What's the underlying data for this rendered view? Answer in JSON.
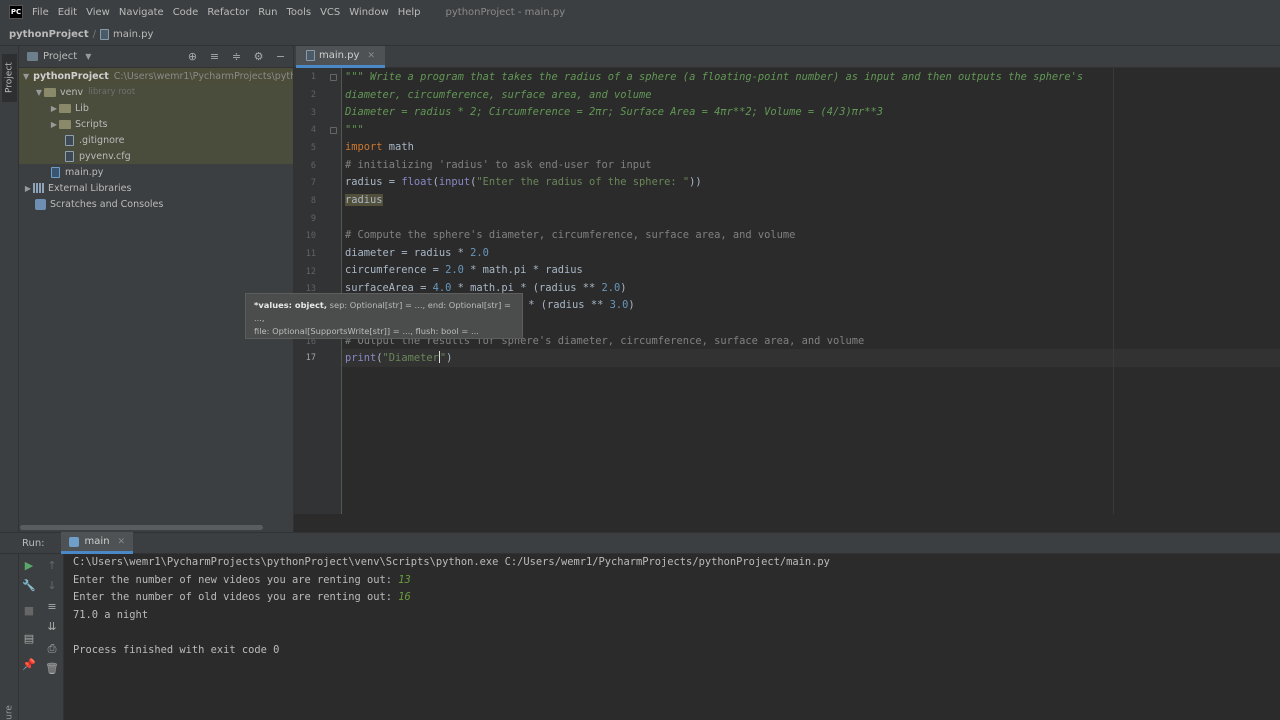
{
  "app": {
    "logo": "PC",
    "window_title": "pythonProject - main.py"
  },
  "menu": [
    "File",
    "Edit",
    "View",
    "Navigate",
    "Code",
    "Refactor",
    "Run",
    "Tools",
    "VCS",
    "Window",
    "Help"
  ],
  "breadcrumb": {
    "project": "pythonProject",
    "file": "main.py"
  },
  "left_strip": {
    "project_label": "Project",
    "structure_label": "Structure"
  },
  "project_panel": {
    "title": "Project",
    "tree": [
      {
        "label": "pythonProject",
        "path": "C:\\Users\\wemr1\\PycharmProjects\\pythor",
        "meta": ""
      },
      {
        "label": "venv",
        "meta": "library root"
      },
      {
        "label": "Lib"
      },
      {
        "label": "Scripts"
      },
      {
        "label": ".gitignore"
      },
      {
        "label": "pyvenv.cfg"
      },
      {
        "label": "main.py"
      },
      {
        "label": "External Libraries"
      },
      {
        "label": "Scratches and Consoles"
      }
    ]
  },
  "editor": {
    "tab_label": "main.py",
    "line_numbers": [
      "1",
      "2",
      "3",
      "4",
      "5",
      "6",
      "7",
      "8",
      "9",
      "10",
      "11",
      "12",
      "13",
      "14",
      "15",
      "16",
      "17"
    ],
    "lines": {
      "l1": "\"\"\" Write a program that takes the radius of a sphere (a floating-point number) as input and then outputs the sphere's",
      "l2": "diameter, circumference, surface area, and volume",
      "l3": "Diameter = radius * 2; Circumference = 2πr; Surface Area = 4πr**2; Volume = (4/3)πr**3",
      "l4": "\"\"\"",
      "l5_kw": "import",
      "l5_rest": " math",
      "l6": "# initializing 'radius' to ask end-user for input",
      "l7_a": "radius = ",
      "l7_b": "float",
      "l7_c": "(",
      "l7_d": "input",
      "l7_e": "(",
      "l7_f": "\"Enter the radius of the sphere: \"",
      "l7_g": "))",
      "l8": "radius",
      "l10": "# Compute the sphere's diameter, circumference, surface area, and volume",
      "l11_a": "diameter = radius * ",
      "l11_b": "2.0",
      "l12_a": "circumference = ",
      "l12_b": "2.0",
      "l12_c": " * math.pi * radius",
      "l13_a": "surfaceArea = ",
      "l13_b": "4.0",
      "l13_c": " * math.pi * (radius ** ",
      "l13_d": "2.0",
      "l13_e": ")",
      "l14_a": " * (radius ** ",
      "l14_b": "3.0",
      "l14_c": ")",
      "l16": "# Output the results for sphere's diameter, circumference, surface area, and volume",
      "l17_a": "print",
      "l17_b": "(",
      "l17_c": "\"Diameter",
      "l17_d": "\"",
      "l17_e": ")"
    },
    "tooltip": {
      "bold": "*values: object,",
      "line1_rest": " sep: Optional[str] = ..., end: Optional[str] = ...,",
      "line2": "file: Optional[SupportsWrite[str]] = ..., flush: bool = ..."
    }
  },
  "run_panel": {
    "label": "Run:",
    "tab_label": "main",
    "console": {
      "cmd": "C:\\Users\\wemr1\\PycharmProjects\\pythonProject\\venv\\Scripts\\python.exe C:/Users/wemr1/PycharmProjects/pythonProject/main.py",
      "prompt1": "Enter the number of new videos you are renting out: ",
      "input1": "13",
      "prompt2": "Enter the number of old videos you are renting out: ",
      "input2": "16",
      "result": "71.0 a night",
      "exit": "Process finished with exit code 0"
    }
  },
  "colors": {
    "accent": "#4a88c7",
    "keyword": "#cc7832",
    "string": "#6a8759",
    "number": "#6897bb",
    "comment": "#808080",
    "docstring": "#629755"
  }
}
